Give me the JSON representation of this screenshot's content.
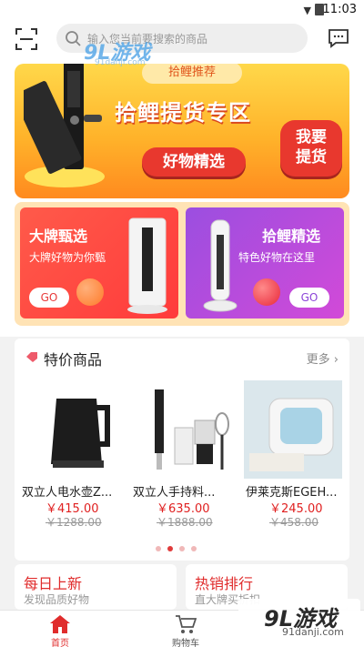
{
  "status_bar": {
    "time": "11:03"
  },
  "search": {
    "placeholder": "输入您当前要搜索的商品"
  },
  "banner": {
    "ribbon": "拾鲤推荐",
    "title": "拾鲤提货专区",
    "pill": "好物精选",
    "bubble_line1": "我要",
    "bubble_line2": "提货"
  },
  "promo_cards": [
    {
      "title": "大牌甄选",
      "subtitle": "大牌好物为你甄",
      "go": "GO"
    },
    {
      "title": "拾鲤精选",
      "subtitle": "特色好物在这里",
      "go": "GO"
    }
  ],
  "special": {
    "title": "特价商品",
    "more": "更多 ›",
    "items": [
      {
        "name": "双立人电水壶Z...",
        "price": "￥415.00",
        "old_price": "￥1288.00"
      },
      {
        "name": "双立人手持料...",
        "price": "￥635.00",
        "old_price": "￥1888.00"
      },
      {
        "name": "伊莱克斯EGEH...",
        "price": "￥245.00",
        "old_price": "￥458.00"
      }
    ]
  },
  "sections": [
    {
      "title": "每日上新",
      "subtitle": "发现品质好物"
    },
    {
      "title": "热销排行",
      "subtitle": "直大牌买折扣"
    }
  ],
  "tabs": [
    {
      "label": "首页",
      "active": true
    },
    {
      "label": "购物车",
      "active": false
    }
  ],
  "watermark": {
    "brand": "9L游戏",
    "site": "91danji.com",
    "overlay_site": "91danji.com"
  },
  "colors": {
    "accent": "#e02c2c",
    "banner": "#ffb32a",
    "purple": "#9b4ee0"
  }
}
